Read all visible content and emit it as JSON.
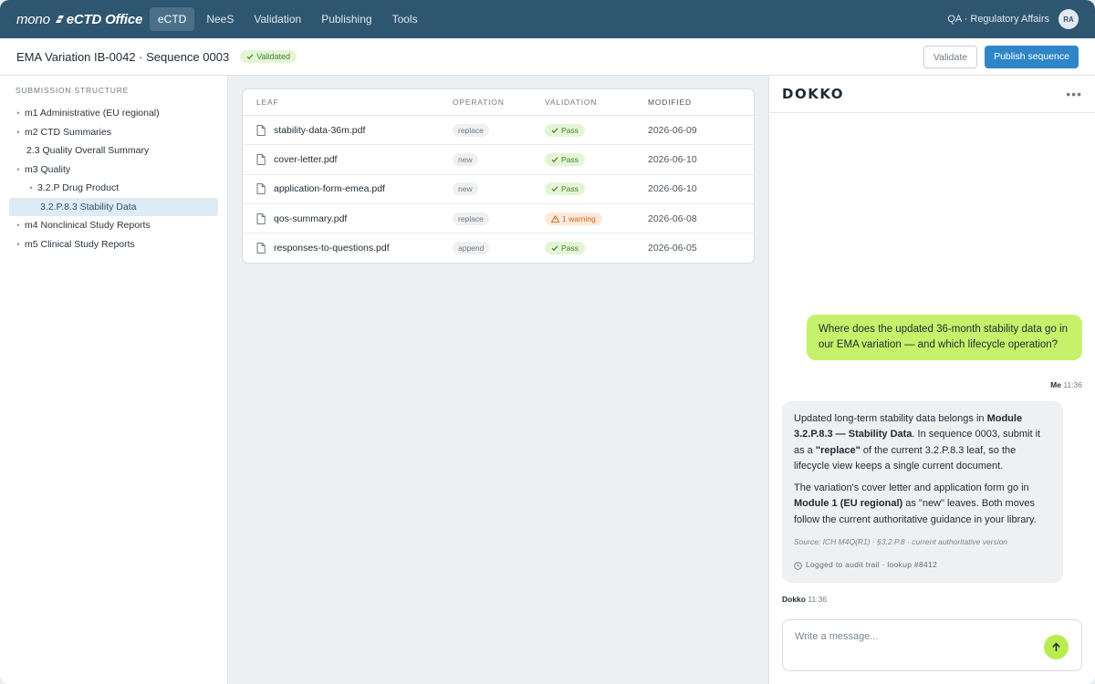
{
  "topbar": {
    "brand_prefix": "mono",
    "brand_name": "eCTD Office",
    "nav": [
      {
        "label": "eCTD",
        "active": true
      },
      {
        "label": "NeeS"
      },
      {
        "label": "Validation"
      },
      {
        "label": "Publishing"
      },
      {
        "label": "Tools"
      }
    ],
    "user_label": "QA · Regulatory Affairs",
    "avatar_initials": "RA"
  },
  "subheader": {
    "title": "EMA Variation IB-0042 · Sequence 0003",
    "status_badge": "Validated",
    "validate_label": "Validate",
    "publish_label": "Publish sequence"
  },
  "sidebar": {
    "title": "SUBMISSION STRUCTURE",
    "items": [
      {
        "label": "m1 Administrative (EU regional)"
      },
      {
        "label": "m2 CTD Summaries"
      },
      {
        "label": "2.3 Quality Overall Summary"
      },
      {
        "label": "m3 Quality"
      },
      {
        "label": "3.2.P Drug Product"
      },
      {
        "label": "3.2.P.8.3 Stability Data"
      },
      {
        "label": "m4 Nonclinical Study Reports"
      },
      {
        "label": "m5 Clinical Study Reports"
      }
    ]
  },
  "table": {
    "headers": {
      "leaf": "LEAF",
      "operation": "OPERATION",
      "validation": "VALIDATION",
      "modified": "MODIFIED"
    },
    "rows": [
      {
        "leaf": "stability-data-36m.pdf",
        "operation": "replace",
        "validation": "Pass",
        "modified": "2026-06-09"
      },
      {
        "leaf": "cover-letter.pdf",
        "operation": "new",
        "validation": "Pass",
        "modified": "2026-06-10"
      },
      {
        "leaf": "application-form-emea.pdf",
        "operation": "new",
        "validation": "Pass",
        "modified": "2026-06-10"
      },
      {
        "leaf": "qos-summary.pdf",
        "operation": "replace",
        "validation": "1 warning",
        "modified": "2026-06-08"
      },
      {
        "leaf": "responses-to-questions.pdf",
        "operation": "append",
        "validation": "Pass",
        "modified": "2026-06-05"
      }
    ]
  },
  "chat": {
    "logo": "DOKKO",
    "user_message": "Where does the updated 36-month stability data go in our EMA variation — and which lifecycle operation?",
    "user_name": "Me",
    "user_time": "11:36",
    "bot_p1_a": "Updated long-term stability data belongs in ",
    "bot_p1_b": "Module 3.2.P.8.3 — Stability Data",
    "bot_p1_c": ". In sequence 0003, submit it as a ",
    "bot_p1_d": "\"replace\"",
    "bot_p1_e": " of the current 3.2.P.8.3 leaf, so the lifecycle view keeps a single current document.",
    "bot_p2_a": "The variation's cover letter and application form go in ",
    "bot_p2_b": "Module 1 (EU regional)",
    "bot_p2_c": " as \"new\" leaves. Both moves follow the current authoritative guidance in your library.",
    "source": "Source: ICH M4Q(R1) · §3.2.P.8 · current authoritative version",
    "audit": "Logged to audit trail · lookup #8412",
    "bot_name": "Dokko",
    "bot_time": "11:36",
    "composer_placeholder": "Write a message..."
  },
  "colors": {
    "topbar": "#2f5670",
    "primary": "#2e86c8",
    "user_bubble": "#c5f26a",
    "pass": "#4b7f2a",
    "warning": "#c76a22"
  }
}
